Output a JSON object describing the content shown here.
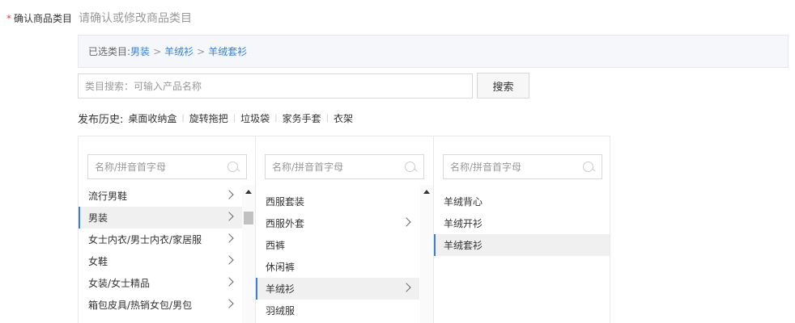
{
  "form": {
    "required_mark": "*",
    "label": "确认商品类目",
    "hint": "请确认或修改商品类目"
  },
  "selected": {
    "prefix": "已选类目:",
    "path": [
      "男装",
      "羊绒衫",
      "羊绒套衫"
    ],
    "separator": ">"
  },
  "search": {
    "placeholder": "类目搜索：可输入产品名称",
    "button_label": "搜索"
  },
  "history": {
    "label": "发布历史:",
    "items": [
      "桌面收纳盒",
      "旋转拖把",
      "垃圾袋",
      "家务手套",
      "衣架"
    ],
    "separator": "|"
  },
  "columns": [
    {
      "filter_placeholder": "名称/拼音首字母",
      "items": [
        {
          "label": "流行男鞋",
          "has_children": true
        },
        {
          "label": "男装",
          "has_children": true,
          "active": true
        },
        {
          "label": "女士内衣/男士内衣/家居服",
          "has_children": true
        },
        {
          "label": "女鞋",
          "has_children": true
        },
        {
          "label": "女装/女士精品",
          "has_children": true
        },
        {
          "label": "箱包皮具/热销女包/男包",
          "has_children": true
        }
      ]
    },
    {
      "filter_placeholder": "名称/拼音首字母",
      "items": [
        {
          "label": "西服套装",
          "has_children": false
        },
        {
          "label": "西服外套",
          "has_children": true
        },
        {
          "label": "西裤",
          "has_children": false
        },
        {
          "label": "休闲裤",
          "has_children": false
        },
        {
          "label": "羊绒衫",
          "has_children": true,
          "active": true
        },
        {
          "label": "羽绒服",
          "has_children": false
        }
      ]
    },
    {
      "filter_placeholder": "名称/拼音首字母",
      "items": [
        {
          "label": "羊绒背心",
          "has_children": false
        },
        {
          "label": "羊绒开衫",
          "has_children": false
        },
        {
          "label": "羊绒套衫",
          "has_children": false,
          "active": true
        }
      ]
    }
  ],
  "colors": {
    "accent": "#3a7fd5",
    "required": "#e4393c"
  }
}
